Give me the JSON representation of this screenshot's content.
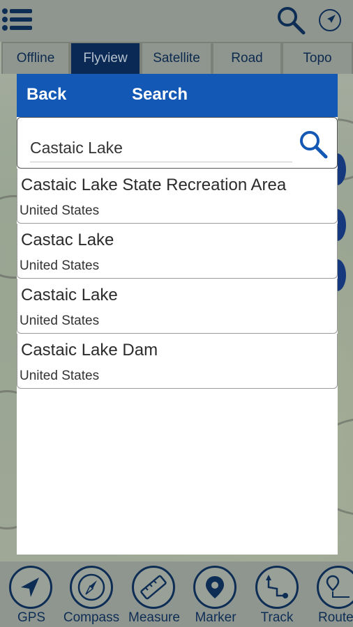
{
  "top_bar": {
    "menu_icon": "menu-list-icon",
    "search_icon": "search-icon",
    "navigate_icon": "navigation-arrow-icon"
  },
  "map_tabs": [
    {
      "label": "Offline",
      "active": false
    },
    {
      "label": "Flyview",
      "active": true
    },
    {
      "label": "Satellite",
      "active": false
    },
    {
      "label": "Road",
      "active": false
    },
    {
      "label": "Topo",
      "active": false
    }
  ],
  "search_dialog": {
    "back_label": "Back",
    "title": "Search",
    "query": "Castaic Lake",
    "search_icon": "search-icon",
    "header_color": "#1358b4",
    "results": [
      {
        "name": "Castaic Lake State Recreation Area",
        "country": "United States"
      },
      {
        "name": "Castac Lake",
        "country": "United States"
      },
      {
        "name": "Castaic Lake",
        "country": "United States"
      },
      {
        "name": "Castaic Lake Dam",
        "country": "United States"
      }
    ]
  },
  "bottom_tools": [
    {
      "label": "GPS",
      "icon": "gps-arrow-icon"
    },
    {
      "label": "Compass",
      "icon": "compass-icon"
    },
    {
      "label": "Measure",
      "icon": "ruler-icon"
    },
    {
      "label": "Marker",
      "icon": "map-marker-icon"
    },
    {
      "label": "Track",
      "icon": "track-icon"
    },
    {
      "label": "Route",
      "icon": "route-icon"
    }
  ],
  "colors": {
    "accent_dark": "#0e2d55",
    "active_tab": "#0a2a55"
  }
}
